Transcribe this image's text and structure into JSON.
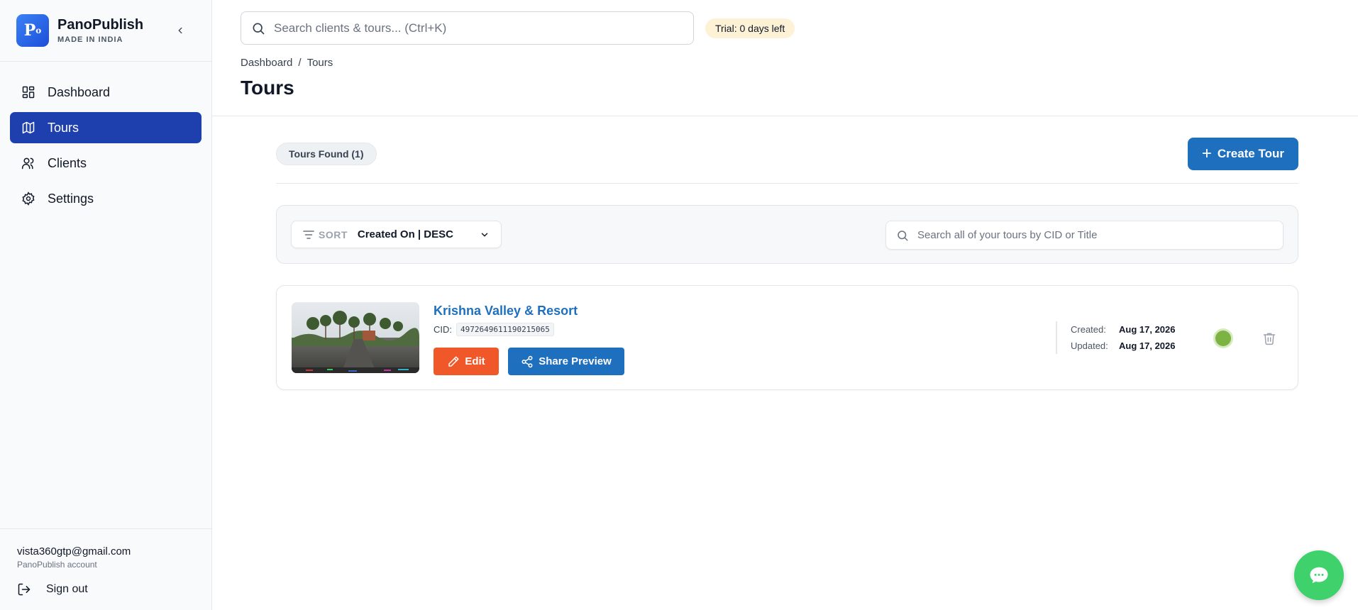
{
  "brand": {
    "logo_text": "P",
    "logo_sup": "o",
    "name": "PanoPublish",
    "tagline": "MADE IN INDIA"
  },
  "sidebar": {
    "items": [
      {
        "label": "Dashboard",
        "icon": "dashboard-grid-icon",
        "active": false
      },
      {
        "label": "Tours",
        "icon": "map-icon",
        "active": true
      },
      {
        "label": "Clients",
        "icon": "users-icon",
        "active": false
      },
      {
        "label": "Settings",
        "icon": "gear-icon",
        "active": false
      }
    ],
    "user_email": "vista360gtp@gmail.com",
    "user_account": "PanoPublish account",
    "signout_label": "Sign out"
  },
  "header": {
    "search_placeholder": "Search clients & tours... (Ctrl+K)",
    "trial_badge": "Trial: 0 days left",
    "breadcrumb": [
      "Dashboard",
      "Tours"
    ],
    "breadcrumb_sep": "/",
    "title": "Tours"
  },
  "toolbar": {
    "count_label": "Tours Found (1)",
    "create_label": "Create Tour"
  },
  "filters": {
    "sort_label": "SORT",
    "sort_value": "Created On | DESC",
    "search_placeholder": "Search all of your tours by CID or Title"
  },
  "tours": [
    {
      "title": "Krishna Valley & Resort",
      "cid_label": "CID:",
      "cid": "4972649611190215065",
      "edit_label": "Edit",
      "share_label": "Share Preview",
      "created_label": "Created:",
      "created": "Aug 17, 2026",
      "updated_label": "Updated:",
      "updated": "Aug 17, 2026",
      "status_color": "#7cb342"
    }
  ],
  "colors": {
    "primary": "#1f6fbf",
    "nav_active": "#1e40af",
    "edit": "#f0582a",
    "chat": "#3fd16b"
  }
}
